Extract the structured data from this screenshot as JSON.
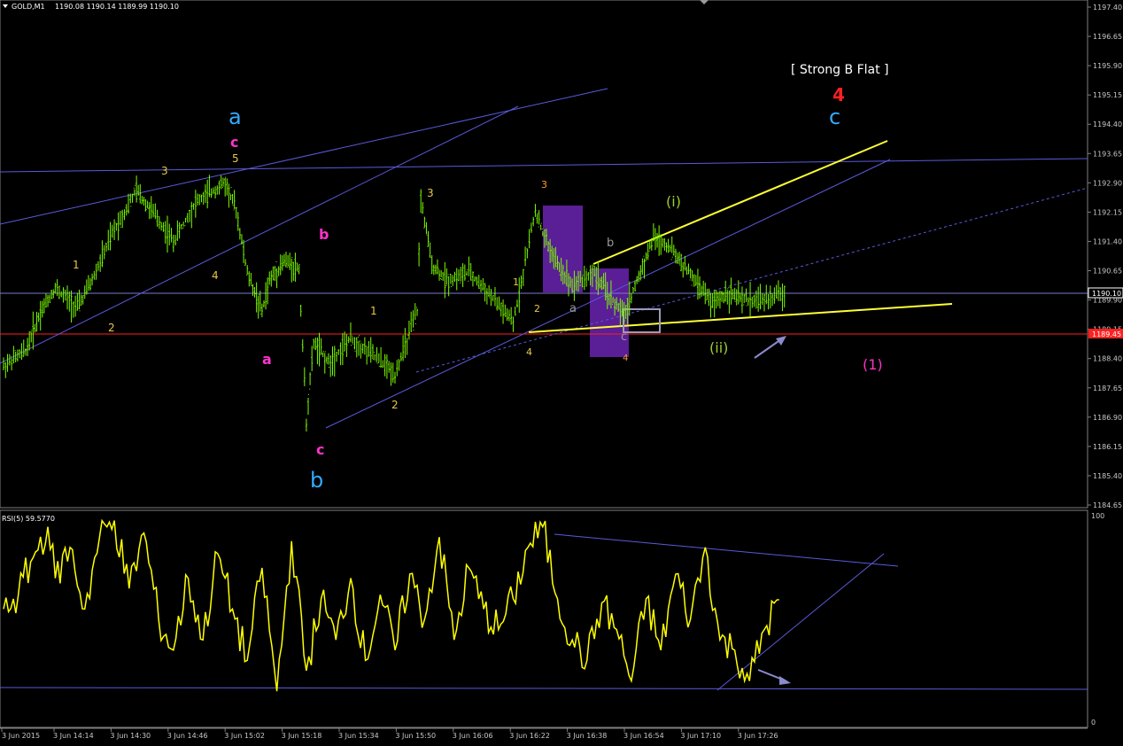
{
  "header": {
    "symbol_label": "GOLD,M1",
    "ohlc_text": "1190.08 1190.14 1189.99 1190.10"
  },
  "rsi_header": "RSI(5) 59.5770",
  "price_badge": "1190.10",
  "red_level_badge": "1189.45",
  "annotations": {
    "strong_b_flat": "[ Strong B Flat ]",
    "wave_4_red": "4",
    "wave_c_big": "c",
    "wave_a_big": "a",
    "wave_b_big": "b",
    "wave_c_mag_top": "c",
    "wave_b_mag": "b",
    "wave_a_mag": "a",
    "wave_c_mag_bottom": "c",
    "wave_1_paren": "(1)",
    "wave_i": "(i)",
    "wave_ii": "(ii)",
    "small_labels": [
      {
        "id": "s1",
        "text": "3",
        "color": "#e8c84a"
      },
      {
        "id": "s2",
        "text": "5",
        "color": "#e8c84a"
      },
      {
        "id": "s3",
        "text": "1",
        "color": "#e8c84a"
      },
      {
        "id": "s4",
        "text": "2",
        "color": "#e8c84a"
      },
      {
        "id": "s5",
        "text": "4",
        "color": "#e8c84a"
      },
      {
        "id": "s6",
        "text": "3",
        "color": "#e8c84a"
      },
      {
        "id": "s7",
        "text": "1",
        "color": "#e8c84a"
      },
      {
        "id": "s8",
        "text": "2",
        "color": "#e8c84a"
      },
      {
        "id": "s9",
        "text": "1",
        "color": "#e8c84a"
      },
      {
        "id": "s10",
        "text": "2",
        "color": "#e8c84a"
      },
      {
        "id": "s11",
        "text": "4",
        "color": "#e8c84a"
      },
      {
        "id": "s12",
        "text": "3",
        "color": "#ff9933"
      },
      {
        "id": "s13",
        "text": "4",
        "color": "#ff9933"
      },
      {
        "id": "s14",
        "text": "a",
        "color": "#999999"
      },
      {
        "id": "s15",
        "text": "b",
        "color": "#999999"
      },
      {
        "id": "s16",
        "text": "c",
        "color": "#999999"
      }
    ]
  },
  "colors": {
    "background": "#000000",
    "candle": "#7CFC00",
    "trendline": "#5a5adc",
    "yellow_line": "#ffff33",
    "red_line": "#ff2020",
    "rsi_line": "#ffff00",
    "purple_box": "#5a1e96",
    "cyan_label": "#33aaff",
    "magenta_label": "#ff33cc",
    "olive_label": "#9acd32"
  },
  "chart_data": [
    {
      "type": "line",
      "name": "GOLD,M1 price",
      "ylim": [
        1184.65,
        1197.4
      ],
      "y_ticks": [
        "1197.40",
        "1196.65",
        "1195.90",
        "1195.15",
        "1194.40",
        "1193.65",
        "1192.90",
        "1192.15",
        "1191.40",
        "1190.65",
        "1189.90",
        "1189.15",
        "1188.40",
        "1187.65",
        "1186.90",
        "1186.15",
        "1185.40",
        "1184.65"
      ],
      "x_ticks": [
        "3 Jun 2015",
        "3 Jun 14:14",
        "3 Jun 14:30",
        "3 Jun 14:46",
        "3 Jun 15:02",
        "3 Jun 15:18",
        "3 Jun 15:34",
        "3 Jun 15:50",
        "3 Jun 16:06",
        "3 Jun 16:22",
        "3 Jun 16:38",
        "3 Jun 16:54",
        "3 Jun 17:10",
        "3 Jun 17:26"
      ],
      "x": [
        "14:00",
        "14:06",
        "14:10",
        "14:14",
        "14:20",
        "14:24",
        "14:30",
        "14:36",
        "14:40",
        "14:46",
        "14:52",
        "15:00",
        "15:03",
        "15:06",
        "15:10",
        "15:12",
        "15:16",
        "15:20",
        "15:22",
        "15:24",
        "15:28",
        "15:34",
        "15:40",
        "15:46",
        "15:52",
        "15:53",
        "15:56",
        "16:00",
        "16:06",
        "16:12",
        "16:18",
        "16:24",
        "16:26",
        "16:30",
        "16:34",
        "16:40",
        "16:44",
        "16:48",
        "16:52",
        "16:56",
        "17:00",
        "17:04",
        "17:08",
        "17:12",
        "17:16",
        "17:20",
        "17:26",
        "17:32"
      ],
      "values": [
        1188.2,
        1188.6,
        1189.6,
        1190.2,
        1189.7,
        1190.4,
        1191.7,
        1192.7,
        1192.2,
        1191.4,
        1192.4,
        1192.9,
        1192.2,
        1190.6,
        1189.6,
        1190.4,
        1190.9,
        1190.7,
        1186.8,
        1188.8,
        1188.3,
        1188.9,
        1188.5,
        1188.0,
        1189.6,
        1192.5,
        1190.8,
        1190.4,
        1190.6,
        1190.0,
        1189.3,
        1192.2,
        1191.6,
        1190.8,
        1190.3,
        1190.6,
        1190.0,
        1189.5,
        1190.5,
        1191.5,
        1191.3,
        1190.8,
        1190.3,
        1189.8,
        1190.1,
        1189.9,
        1189.9,
        1190.1
      ],
      "current_price": 1190.1,
      "red_level": 1189.45
    },
    {
      "type": "line",
      "name": "RSI(5)",
      "ylim": [
        0,
        100
      ],
      "y_ticks": [
        "100",
        "0"
      ],
      "x": [
        "14:00",
        "14:04",
        "14:08",
        "14:12",
        "14:14",
        "14:18",
        "14:22",
        "14:26",
        "14:30",
        "14:34",
        "14:38",
        "14:42",
        "14:46",
        "14:50",
        "14:54",
        "14:58",
        "15:02",
        "15:06",
        "15:10",
        "15:14",
        "15:18",
        "15:22",
        "15:26",
        "15:30",
        "15:34",
        "15:38",
        "15:42",
        "15:46",
        "15:50",
        "15:54",
        "15:58",
        "16:02",
        "16:06",
        "16:10",
        "16:14",
        "16:18",
        "16:22",
        "16:26",
        "16:30",
        "16:34",
        "16:38",
        "16:42",
        "16:46",
        "16:50",
        "16:54",
        "16:58",
        "17:02",
        "17:06",
        "17:10",
        "17:14",
        "17:18",
        "17:22",
        "17:26",
        "17:30"
      ],
      "values": [
        55,
        62,
        80,
        95,
        70,
        85,
        55,
        90,
        98,
        65,
        92,
        50,
        35,
        70,
        40,
        82,
        55,
        30,
        75,
        15,
        88,
        25,
        60,
        40,
        70,
        30,
        62,
        35,
        72,
        50,
        90,
        40,
        75,
        55,
        45,
        60,
        85,
        95,
        60,
        40,
        30,
        58,
        45,
        20,
        60,
        35,
        72,
        50,
        85,
        40,
        35,
        20,
        45,
        59.58
      ]
    }
  ]
}
